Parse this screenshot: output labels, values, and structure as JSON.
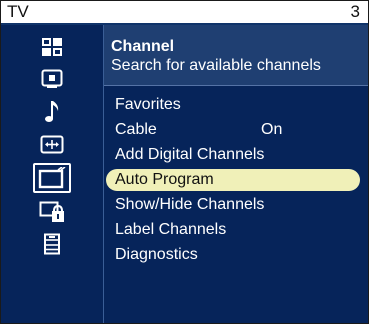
{
  "topbar": {
    "title": "TV",
    "page_number": "3"
  },
  "sidebar": {
    "icons": [
      {
        "name": "picture-grid-icon"
      },
      {
        "name": "screen-icon"
      },
      {
        "name": "music-note-icon"
      },
      {
        "name": "aspect-arrows-icon"
      },
      {
        "name": "channel-tv-icon",
        "selected": true
      },
      {
        "name": "lock-icon"
      },
      {
        "name": "setup-list-icon"
      }
    ]
  },
  "header": {
    "title": "Channel",
    "subtitle": "Search for available channels"
  },
  "menu": {
    "items": [
      {
        "label": "Favorites",
        "value": ""
      },
      {
        "label": "Cable",
        "value": "On"
      },
      {
        "label": "Add Digital Channels",
        "value": ""
      },
      {
        "label": "Auto Program",
        "value": "",
        "highlighted": true
      },
      {
        "label": "Show/Hide Channels",
        "value": ""
      },
      {
        "label": "Label Channels",
        "value": ""
      },
      {
        "label": "Diagnostics",
        "value": ""
      }
    ]
  },
  "colors": {
    "background": "#06245a",
    "header": "#1f3f72",
    "highlight": "#f0f0b8"
  }
}
